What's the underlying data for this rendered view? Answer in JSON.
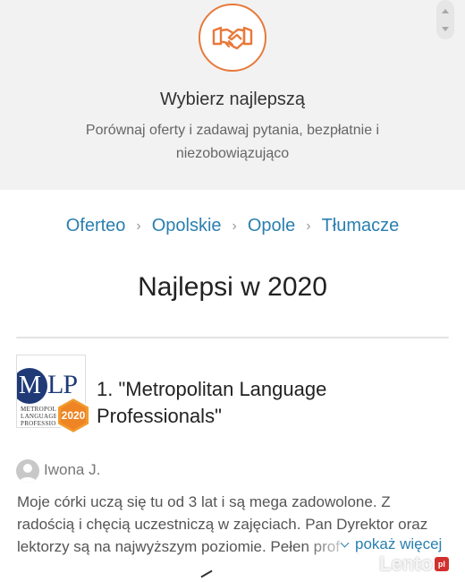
{
  "hero": {
    "icon": "handshake-icon",
    "title": "Wybierz najlepszą",
    "subtitle": "Porównaj oferty i zadawaj pytania, bezpłatnie i niezobowiązująco",
    "accent_color": "#e8793a"
  },
  "breadcrumb": {
    "items": [
      "Oferteo",
      "Opolskie",
      "Opole",
      "Tłumacze"
    ],
    "link_color": "#2a7fb0"
  },
  "page": {
    "title": "Najlepsi w 2020"
  },
  "listing": {
    "title": "1. \"Metropolitan Language Professionals\"",
    "logo": {
      "letters_left": "M",
      "letters_right": "LP",
      "line1": "METROPOLITAN",
      "line2": "LANGUAGE PROFESSIONALS"
    },
    "badge_year": "2020"
  },
  "review": {
    "author": "Iwona J.",
    "text": "Moje córki uczą się tu od 3 lat i są mega zadowolone. Z radością i chęcią uczestniczą w zajęciach. Pan Dyrektor oraz lektorzy są na najwyższym poziomie. Pełen profesjonalizm.",
    "more_label": "pokaż więcej"
  },
  "watermark": {
    "text": "Lento",
    "suffix": "pl"
  }
}
